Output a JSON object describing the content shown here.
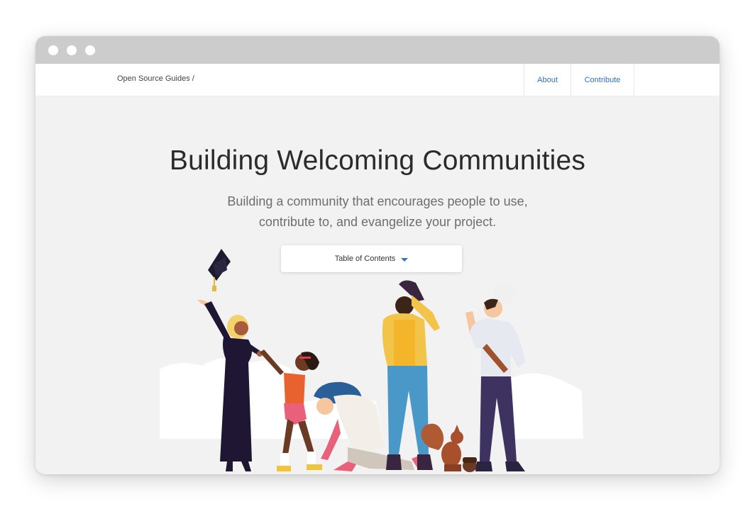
{
  "nav": {
    "brand": "Open Source Guides /",
    "links": [
      {
        "label": "About"
      },
      {
        "label": "Contribute"
      }
    ]
  },
  "hero": {
    "title": "Building Welcoming Communities",
    "subtitle": "Building a community that encourages people to use, contribute to, and evangelize your project.",
    "toc_label": "Table of Contents"
  },
  "colors": {
    "background": "#f2f2f2",
    "link": "#2f6fc6",
    "titlebar": "#cccccc"
  },
  "icons": {
    "dropdown": "caret-down-icon"
  }
}
